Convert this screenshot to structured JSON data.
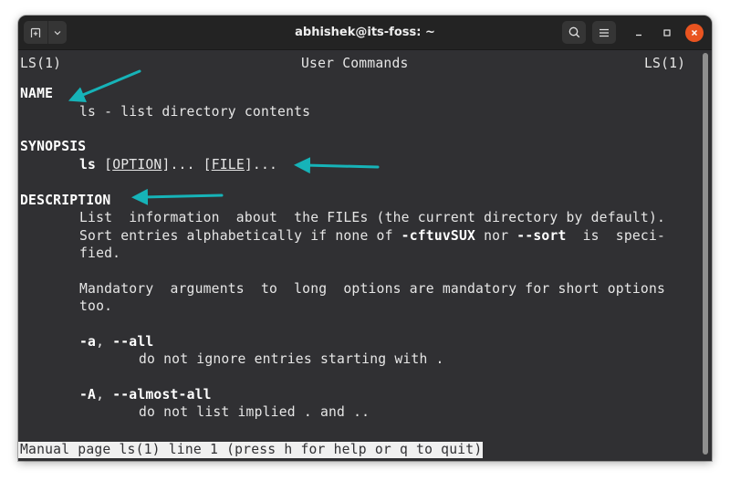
{
  "window": {
    "title": "abhishek@its-foss: ~",
    "new_tab_icon": "new-tab-icon",
    "dropdown_icon": "chevron-down-icon",
    "search_icon": "search-icon",
    "menu_icon": "hamburger-menu-icon",
    "minimize_glyph": "–",
    "maximize_glyph": "□",
    "close_glyph": "×"
  },
  "manpage": {
    "header_left": "LS(1)",
    "header_center": "User Commands",
    "header_right": "LS(1)",
    "sections": {
      "name_heading": "NAME",
      "name_text": "ls - list directory contents",
      "synopsis_heading": "SYNOPSIS",
      "synopsis_cmd": "ls",
      "synopsis_open1": " [",
      "synopsis_option": "OPTION",
      "synopsis_close1": "]... [",
      "synopsis_file": "FILE",
      "synopsis_close2": "]...",
      "description_heading": "DESCRIPTION",
      "desc_line1": "List  information  about  the FILEs (the current directory by default).",
      "desc_line2_a": "Sort entries alphabetically if none of ",
      "desc_line2_flags": "-cftuvSUX",
      "desc_line2_b": " nor ",
      "desc_line2_sort": "--sort",
      "desc_line2_c": "  is  speci-",
      "desc_line3": "fied.",
      "mandatory_line1": "Mandatory  arguments  to  long  options are mandatory for short options",
      "mandatory_line2": "too.",
      "opt_a_short": "-a",
      "opt_a_sep": ", ",
      "opt_a_long": "--all",
      "opt_a_desc": "do not ignore entries starting with .",
      "opt_A_short": "-A",
      "opt_A_sep": ", ",
      "opt_A_long": "--almost-all",
      "opt_A_desc": "do not list implied . and .."
    },
    "status_line": "Manual page ls(1) line 1 (press h for help or q to quit)"
  },
  "annotations": {
    "arrow_color": "#16b3b8",
    "arrows": [
      "arrow-to-name",
      "arrow-to-synopsis",
      "arrow-to-description"
    ]
  },
  "colors": {
    "terminal_bg": "#303033",
    "titlebar_bg": "#232323",
    "close_button": "#e95420",
    "text": "#e6e6e6"
  }
}
